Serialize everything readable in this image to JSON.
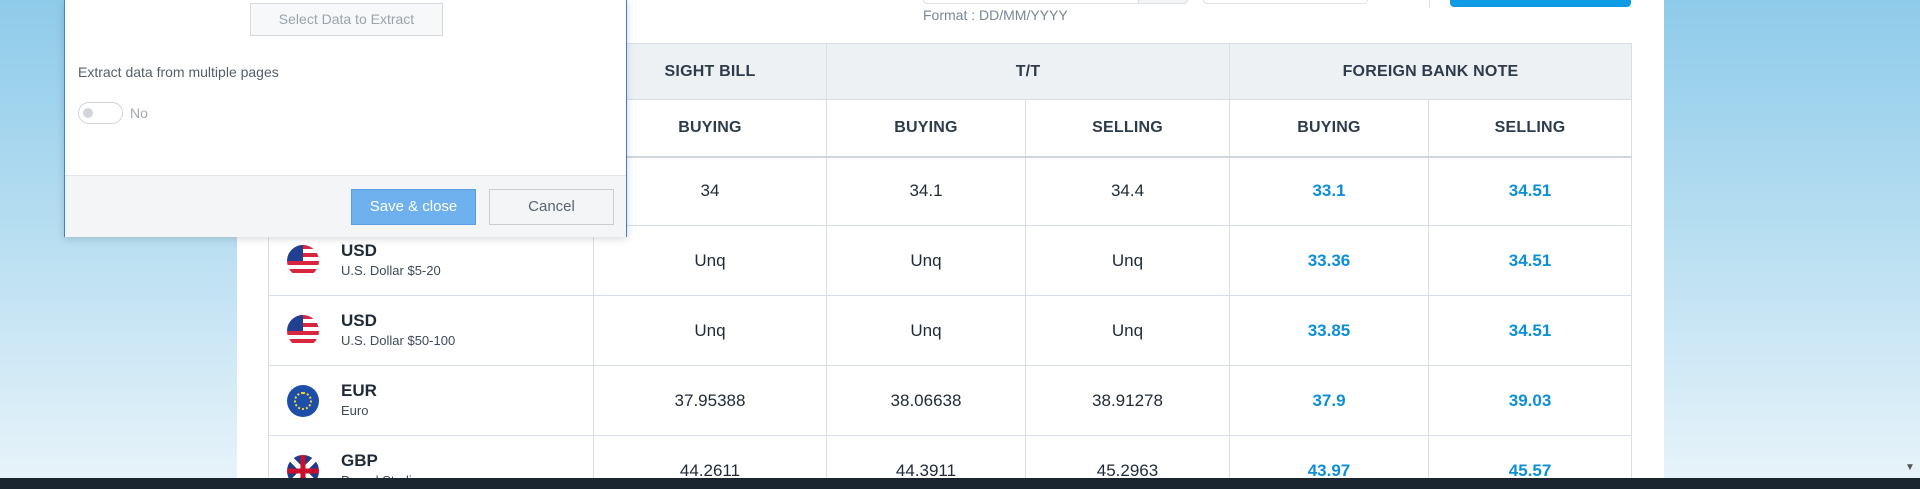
{
  "date_filter": {
    "format_hint": "Format : DD/MM/YYYY"
  },
  "table": {
    "group_headers": [
      "SIGHT BILL",
      "T/T",
      "FOREIGN BANK NOTE"
    ],
    "sub_headers": [
      "BUYING",
      "BUYING",
      "SELLING",
      "BUYING",
      "SELLING"
    ],
    "rows": [
      {
        "code": "",
        "name": "",
        "flag_icon": "",
        "values": [
          "34",
          "34.1",
          "34.4",
          "33.1",
          "34.51"
        ]
      },
      {
        "code": "USD",
        "name": "U.S. Dollar $5-20",
        "flag_icon": "us-flag-icon",
        "values": [
          "Unq",
          "Unq",
          "Unq",
          "33.36",
          "34.51"
        ]
      },
      {
        "code": "USD",
        "name": "U.S. Dollar $50-100",
        "flag_icon": "us-flag-icon",
        "values": [
          "Unq",
          "Unq",
          "Unq",
          "33.85",
          "34.51"
        ]
      },
      {
        "code": "EUR",
        "name": "Euro",
        "flag_icon": "eu-flag-icon",
        "values": [
          "37.95388",
          "38.06638",
          "38.91278",
          "37.9",
          "39.03"
        ]
      },
      {
        "code": "GBP",
        "name": "Pound Sterling",
        "flag_icon": "gb-flag-icon",
        "values": [
          "44.2611",
          "44.3911",
          "45.2963",
          "43.97",
          "45.57"
        ]
      }
    ]
  },
  "dialog": {
    "select_data_label": "Select Data to Extract",
    "multi_page_label": "Extract data from multiple pages",
    "toggle_value": "No",
    "save_label": "Save & close",
    "cancel_label": "Cancel"
  },
  "colors": {
    "accent": "#0f9be3",
    "fbn_value": "#0d8fd6",
    "save_button": "#6fb1ee"
  }
}
